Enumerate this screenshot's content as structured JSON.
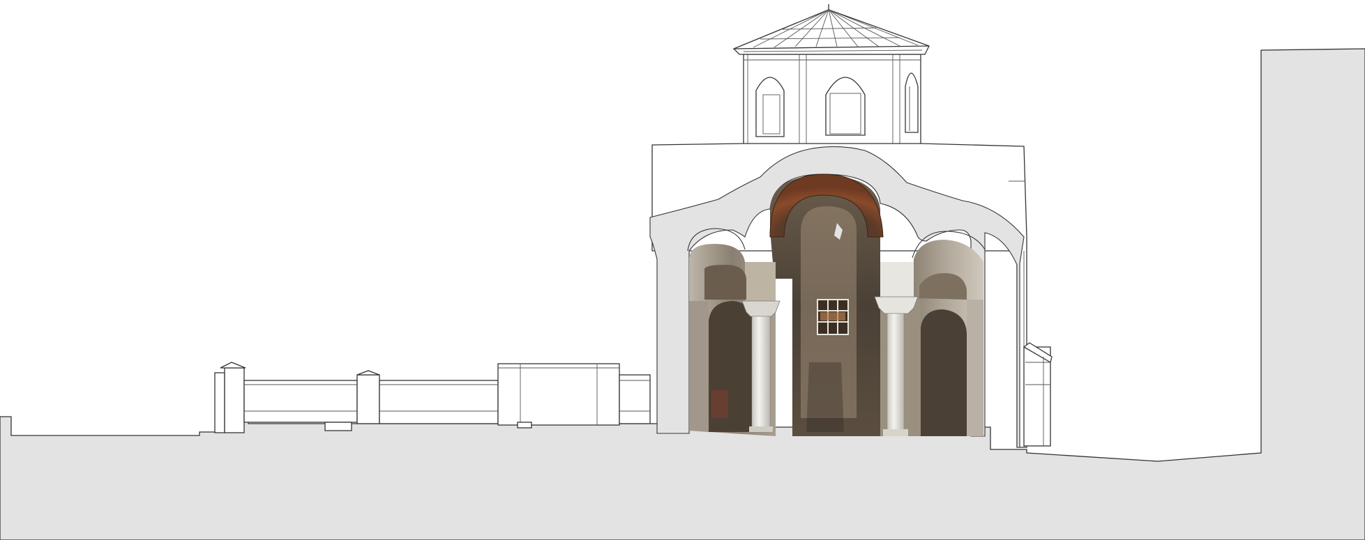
{
  "drawing": {
    "type": "architectural-section",
    "colors": {
      "background": "#ffffff",
      "section_fill": "#e3e3e3",
      "outline": "#333333",
      "photo_dark": "#3d342c",
      "photo_mid": "#7d7263",
      "photo_light": "#cfc8bd",
      "brick_arch": "#7a3e22",
      "column_white": "#ecebe6"
    },
    "elements": [
      "ground-section",
      "courtyard-wall",
      "church-body",
      "drum-with-roof",
      "photo-mosaic-interior",
      "columns",
      "adjacent-building"
    ]
  }
}
